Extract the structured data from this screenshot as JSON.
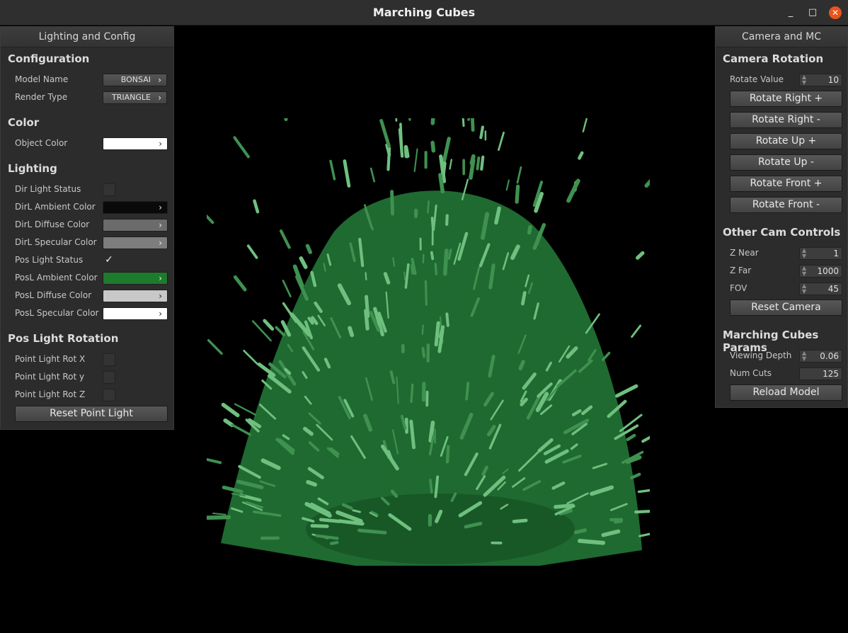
{
  "window": {
    "title": "Marching Cubes"
  },
  "left_panel": {
    "title": "Lighting and Config",
    "config": {
      "heading": "Configuration",
      "model_label": "Model Name",
      "model_value": "BONSAI",
      "render_label": "Render Type",
      "render_value": "TRIANGLE"
    },
    "color": {
      "heading": "Color",
      "object_label": "Object Color",
      "object_color": "#ffffff"
    },
    "lighting": {
      "heading": "Lighting",
      "dir_status_label": "Dir Light Status",
      "dir_status": false,
      "dir_ambient_label": "DirL Ambient Color",
      "dir_ambient": "#0a0a0a",
      "dir_diffuse_label": "DirL Diffuse Color",
      "dir_diffuse": "#6b6b6b",
      "dir_specular_label": "DirL Specular Color",
      "dir_specular": "#7d7d7d",
      "pos_status_label": "Pos Light Status",
      "pos_status": true,
      "pos_check_glyph": "✓",
      "pos_ambient_label": "PosL Ambient Color",
      "pos_ambient": "#1e7a2d",
      "pos_diffuse_label": "PosL Diffuse Color",
      "pos_diffuse": "#c8c8c8",
      "pos_specular_label": "PosL Specular Color",
      "pos_specular": "#ffffff"
    },
    "pos_rotation": {
      "heading": "Pos Light Rotation",
      "rot_x_label": "Point Light Rot X",
      "rot_y_label": "Point Light Rot y",
      "rot_z_label": "Point Light Rot Z",
      "reset_label": "Reset Point Light"
    }
  },
  "right_panel": {
    "title": "Camera and MC",
    "camera_rotation": {
      "heading": "Camera Rotation",
      "rotate_value_label": "Rotate Value",
      "rotate_value": "10",
      "buttons": [
        "Rotate Right +",
        "Rotate Right -",
        "Rotate Up +",
        "Rotate Up -",
        "Rotate Front +",
        "Rotate Front -"
      ]
    },
    "other_cam": {
      "heading": "Other Cam Controls",
      "znear_label": "Z Near",
      "znear": "1",
      "zfar_label": "Z Far",
      "zfar": "1000",
      "fov_label": "FOV",
      "fov": "45",
      "reset_label": "Reset Camera"
    },
    "mc_params": {
      "heading": "Marching Cubes Params",
      "depth_label": "Viewing Depth",
      "depth": "0.06",
      "cuts_label": "Num Cuts",
      "cuts": "125",
      "reload_label": "Reload Model"
    }
  },
  "icons": {
    "chevron": "›",
    "minimize": "_",
    "maximize": "□",
    "close": "✕"
  },
  "colors": {
    "model_base": "#1f6a31",
    "model_highlight": "#6fc07f"
  }
}
